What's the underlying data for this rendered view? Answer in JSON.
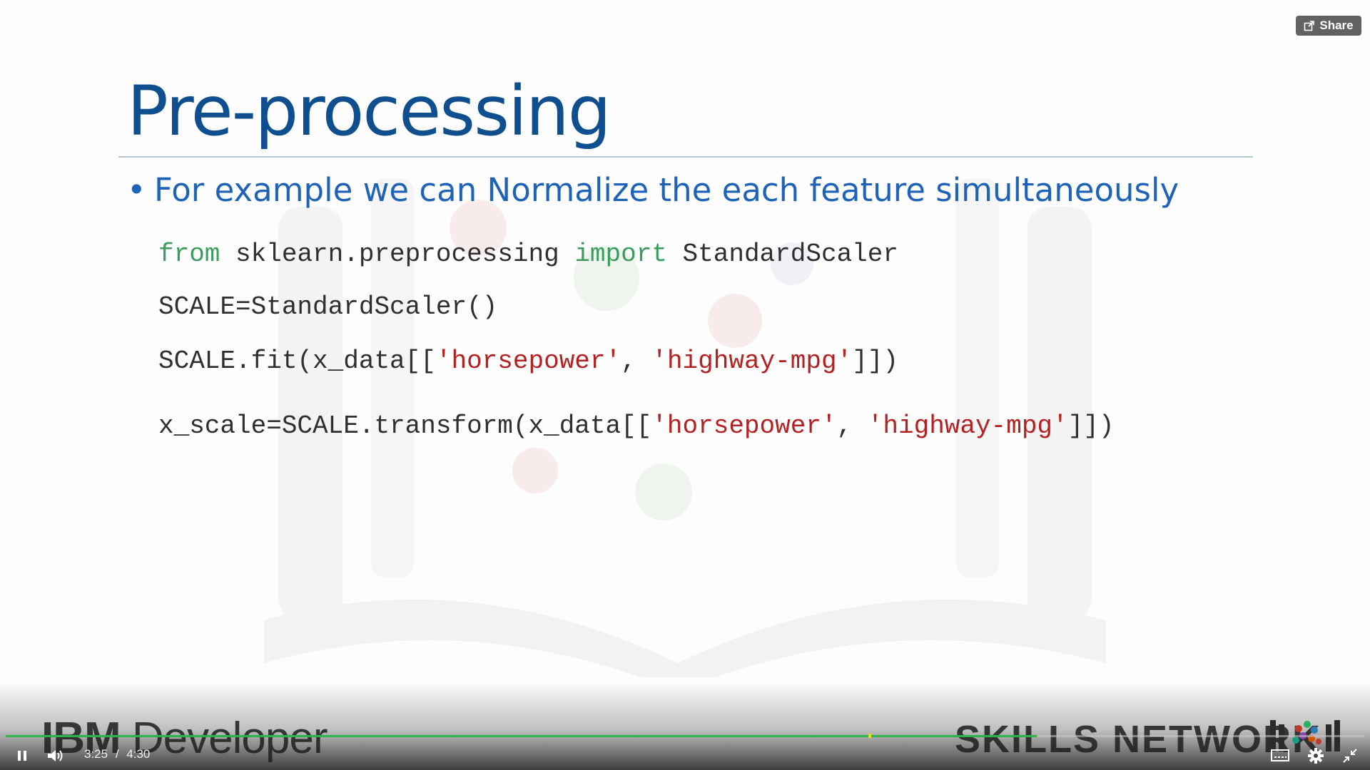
{
  "slide": {
    "title": "Pre-processing",
    "bullet": "For example we can Normalize the each feature simultaneously",
    "code": {
      "line1": {
        "kw1": "from",
        "mod": " sklearn.preprocessing ",
        "kw2": "import",
        "name": " StandardScaler"
      },
      "line2": "SCALE=StandardScaler()",
      "line3": {
        "pre": "SCALE.fit(x_data[[",
        "s1": "'horsepower'",
        "mid": ", ",
        "s2": "'highway-mpg'",
        "post": "]])"
      },
      "line4": {
        "pre": "x_scale=SCALE.transform(x_data[[",
        "s1": "'horsepower'",
        "mid": ", ",
        "s2": "'highway-mpg'",
        "post": "]])"
      }
    }
  },
  "branding": {
    "left_bold": "IBM",
    "left_rest": " Developer",
    "right": "SKILLS NETWORK"
  },
  "player": {
    "share_label": "Share",
    "current_time": "3:25",
    "separator": "/",
    "duration": "4:30",
    "progress_fraction": 0.759,
    "buffer_marker_fraction": 0.635
  },
  "icons": {
    "share": "share-icon",
    "pause": "pause-icon",
    "volume": "volume-icon",
    "captions": "captions-icon",
    "settings": "gear-icon",
    "exit_fullscreen": "exit-fullscreen-icon"
  },
  "colors": {
    "title": "#0f4f8f",
    "bullet": "#1f63b8",
    "keyword": "#3a9d5d",
    "string": "#b22222",
    "progress": "#2db34a"
  }
}
